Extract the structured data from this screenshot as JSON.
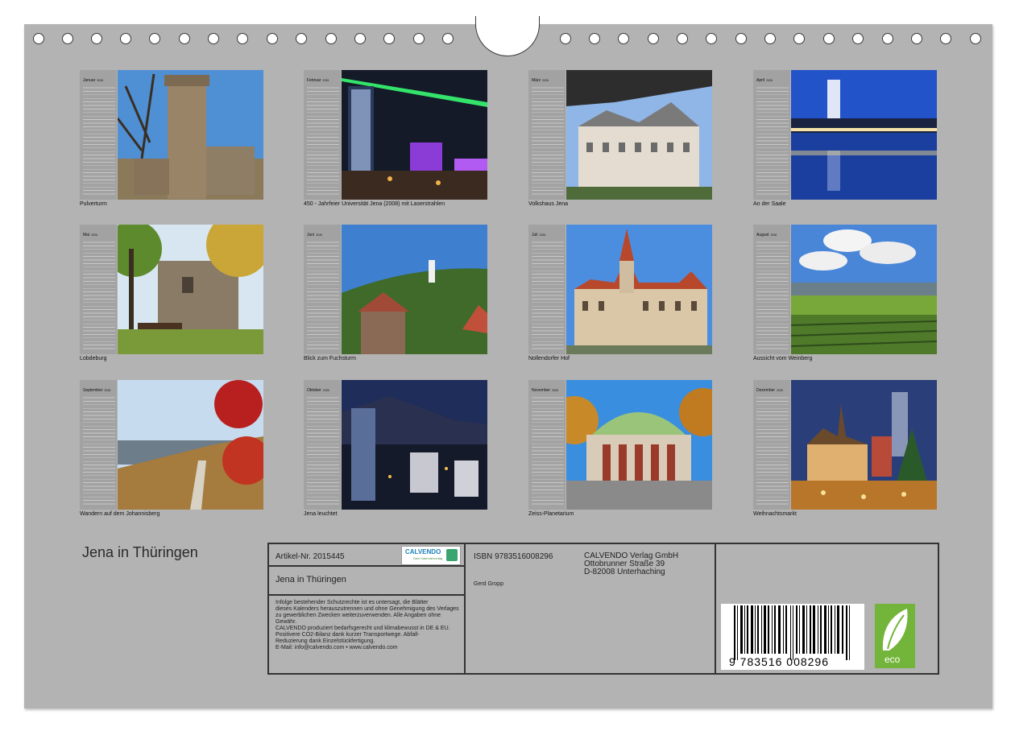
{
  "months": [
    {
      "name": "Januar",
      "year": "2026",
      "caption": "Pulverturm"
    },
    {
      "name": "Februar",
      "year": "2026",
      "caption": "450 - Jahrfeier Universität Jena (2008) mit Laserstrahlen"
    },
    {
      "name": "März",
      "year": "2026",
      "caption": "Volkshaus Jena"
    },
    {
      "name": "April",
      "year": "2026",
      "caption": "An der Saale"
    },
    {
      "name": "Mai",
      "year": "2026",
      "caption": "Lobdeburg"
    },
    {
      "name": "Juni",
      "year": "2026",
      "caption": "Blick zum Fuchsturm"
    },
    {
      "name": "Juli",
      "year": "2026",
      "caption": "Nollendorfer Hof"
    },
    {
      "name": "August",
      "year": "2026",
      "caption": "Aussicht vom Weinberg"
    },
    {
      "name": "September",
      "year": "2026",
      "caption": "Wandern auf dem Johannisberg"
    },
    {
      "name": "Oktober",
      "year": "2026",
      "caption": "Jena leuchtet"
    },
    {
      "name": "November",
      "year": "2026",
      "caption": "Zeiss-Planetarium"
    },
    {
      "name": "Dezember",
      "year": "2026",
      "caption": "Weihnachtsmarkt"
    }
  ],
  "calendar_title": "Jena in Thüringen",
  "info": {
    "article": "Artikel-Nr. 2015445",
    "logo_text": "CALVENDO",
    "logo_sub": "Dein Kalenderverlag",
    "subtitle": "Jena in Thüringen",
    "legal_1": "Infolge bestehender Schutzrechte ist es untersagt, die Blätter",
    "legal_2": "dieses Kalenders herauszutrennen und ohne Genehmigung des Verlages",
    "legal_3": "zu gewerblichen Zwecken weiterzuverwenden. Alle Angaben ohne",
    "legal_4": "Gewähr.",
    "legal_5": "CALVENDO produziert bedarfsgerecht und klimabewusst in DE & EU.",
    "legal_6": "Positivere CO2-Bilanz dank kurzer Transportwege. Abfall-",
    "legal_7": "Reduzierung dank Einzelstückfertigung.",
    "legal_8": "E-Mail: info@calvendo.com • www.calvendo.com",
    "isbn": "ISBN 9783516008296",
    "author": "Gerd Gropp",
    "publisher_1": "CALVENDO Verlag GmbH",
    "publisher_2": "Ottobrunner Straße 39",
    "publisher_3": "D-82008 Unterhaching",
    "barcode_digits": "9 783516 008296",
    "eco_label": "eco"
  }
}
